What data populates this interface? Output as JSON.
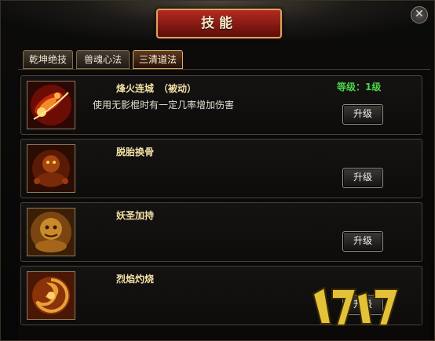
{
  "window": {
    "title": "技能",
    "close_glyph": "✕"
  },
  "tabs": [
    {
      "label": "乾坤绝技",
      "active": false
    },
    {
      "label": "兽魂心法",
      "active": false
    },
    {
      "label": "三清道法",
      "active": true
    }
  ],
  "skills": [
    {
      "name": "烽火连城　（被动）",
      "level": "等级：1级",
      "description": "使用无影棍时有一定几率增加伤害",
      "button": "升级",
      "icon": "fire-strike-icon"
    },
    {
      "name": "脱胎换骨",
      "button": "升级",
      "icon": "red-beast-icon"
    },
    {
      "name": "妖圣加持",
      "button": "升级",
      "icon": "golden-beast-icon"
    },
    {
      "name": "烈焰灼烧",
      "button": "升级",
      "icon": "flame-swirl-icon"
    }
  ],
  "watermark": {
    "text": "17173.com"
  },
  "colors": {
    "accent": "#d9a460",
    "level": "#4ad44a",
    "title_plate": "#9b1f17"
  }
}
